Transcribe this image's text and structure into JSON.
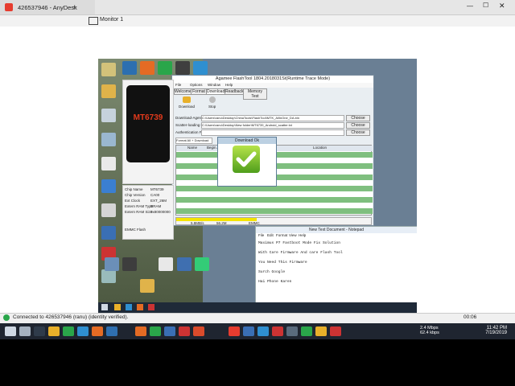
{
  "anydesk": {
    "session_tab": "426537946 - AnyDesk",
    "new_tab": "+",
    "monitor_label": "Monitor 1",
    "status_text": "Connected to 426537946 (ranu) (identity verified)."
  },
  "flashtool": {
    "title": "Agamee FlashTool 1804.2018031St(Runtime Trace Mode)",
    "menu": [
      "File",
      "Options",
      "Window",
      "Help"
    ],
    "tabs": [
      "Welcome",
      "Format",
      "Download",
      "Readback",
      "Memory Test"
    ],
    "download_button": "Download",
    "stop_button": "Stop",
    "download_agent_label": "Download-Agent",
    "download_agent_path": "C:\\Users\\ranu\\Desktop\\ChinaTools\\FlashTool\\MTK_AllInOne_DA.bin",
    "scatter_label": "Scatter-loading File",
    "scatter_path": "C:\\Users\\ranu\\Desktop\\New folder\\MT6739_Android_scatter.txt",
    "auth_label": "Authentication File",
    "choose_label": "Choose",
    "mode_select": "Format All + Download",
    "grid_headers": [
      "Name",
      "Begin Address",
      "End Address",
      "Location"
    ],
    "phone_chip": "MT6739",
    "info_rows": [
      [
        "Chip Name",
        "MT6739"
      ],
      [
        "Chip Version",
        "CA00"
      ],
      [
        "Ext Clock",
        "EXT_26M"
      ],
      [
        "Extern RAM Type",
        "DRAM"
      ],
      [
        "Extern RAM Size",
        "0x80000000"
      ]
    ],
    "emmc_label": "EMMC Flash",
    "progress_left": "5.8MB/s",
    "progress_mid": "56.2M",
    "progress_right": "EMMC"
  },
  "download_ok": {
    "title": "Download Ok"
  },
  "notepad": {
    "title": "New Text Document - Notepad",
    "menu": [
      "File",
      "Edit",
      "Format",
      "View",
      "Help"
    ],
    "lines": [
      "Maximus P7 Fastboot Mode Fix Solution",
      "With Care Firmware And care Flash Tool",
      "You Need This Firmware",
      "Surch Google",
      "Hai Phone Karen"
    ]
  },
  "taskbar": {
    "net_up": "2.4 Mbps",
    "net_down": "62.4 kbps",
    "time": "11:42 PM",
    "date": "7/19/2019",
    "session_time": "00:06"
  }
}
